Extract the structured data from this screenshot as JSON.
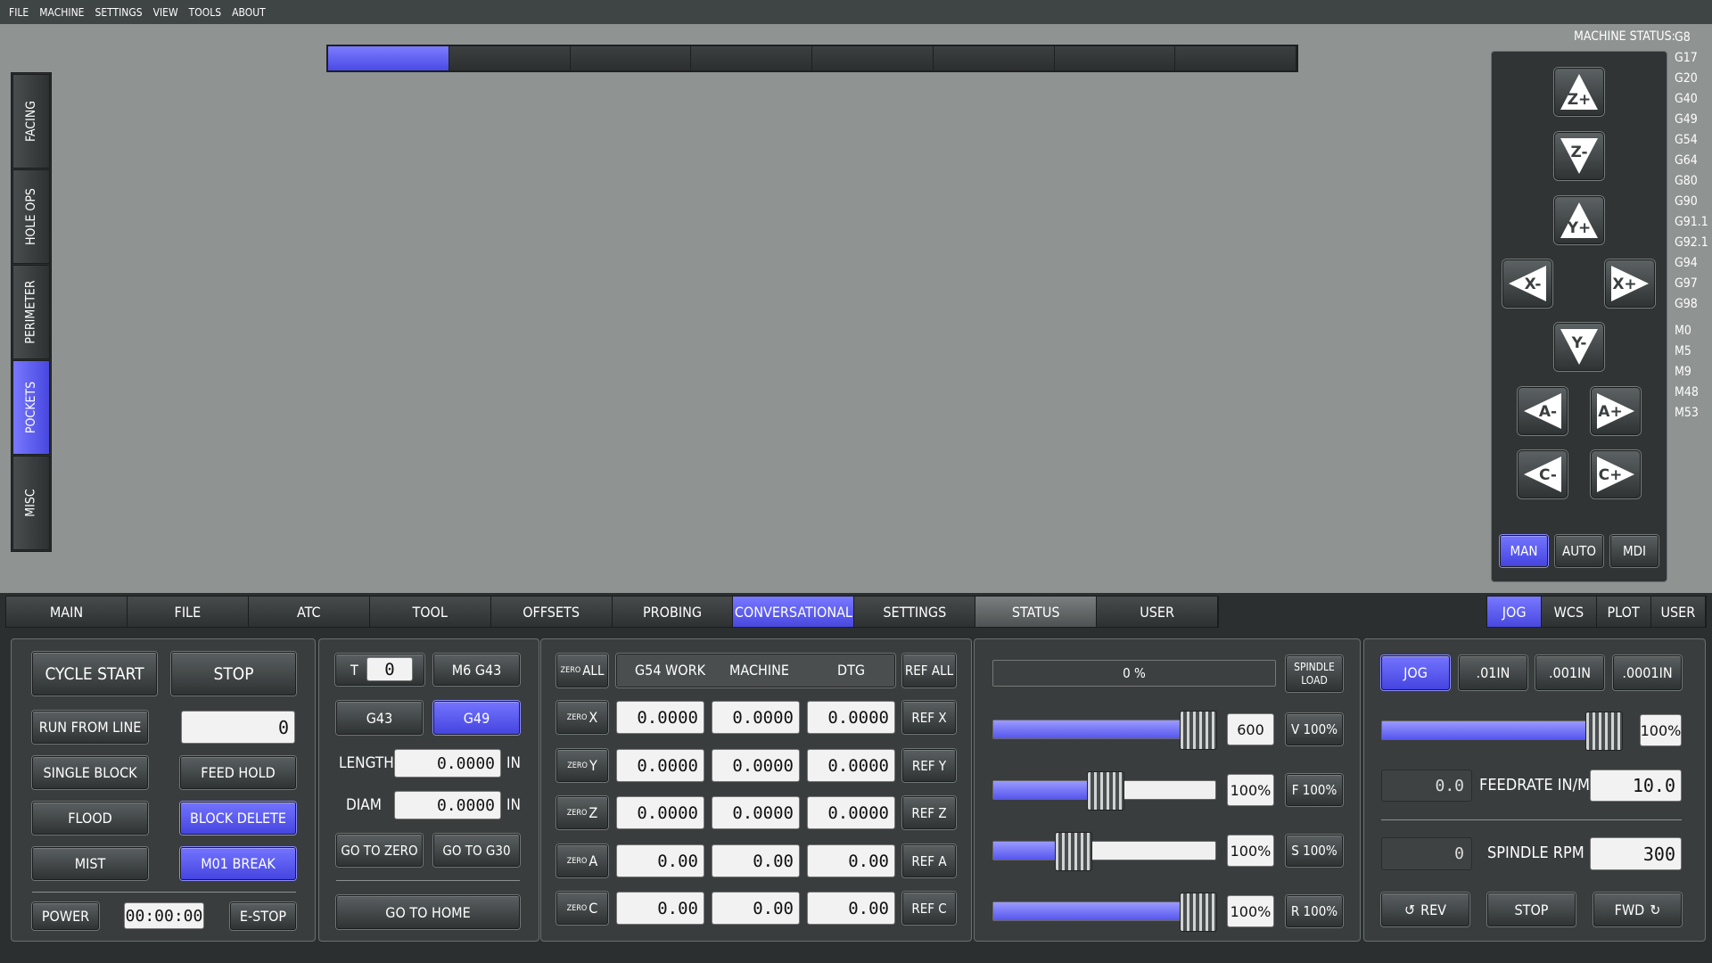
{
  "menu": [
    "FILE",
    "MACHINE",
    "SETTINGS",
    "VIEW",
    "TOOLS",
    "ABOUT"
  ],
  "machine_status_label": "MACHINE STATUS:",
  "gcodes": [
    "G8",
    "G17",
    "G20",
    "G40",
    "G49",
    "G54",
    "G64",
    "G80",
    "G90",
    "G91.1",
    "G92.1",
    "G94",
    "G97",
    "G98"
  ],
  "mcodes": [
    "M0",
    "M5",
    "M9",
    "M48",
    "M53"
  ],
  "side_tabs": [
    "FACING",
    "HOLE OPS",
    "PERIMETER",
    "POCKETS",
    "MISC"
  ],
  "side_tab_active": 3,
  "jog": {
    "z_plus": "Z+",
    "z_minus": "Z-",
    "y_plus": "Y+",
    "y_minus": "Y-",
    "x_minus": "X-",
    "x_plus": "X+",
    "a_minus": "A-",
    "a_plus": "A+",
    "c_minus": "C-",
    "c_plus": "C+"
  },
  "mode_buttons": [
    "MAN",
    "AUTO",
    "MDI"
  ],
  "main_tabs": [
    "MAIN",
    "FILE",
    "ATC",
    "TOOL",
    "OFFSETS",
    "PROBING",
    "CONVERSATIONAL",
    "SETTINGS",
    "STATUS",
    "USER"
  ],
  "right_tabs": [
    "JOG",
    "WCS",
    "PLOT",
    "USER"
  ],
  "controls": {
    "cycle_start": "CYCLE START",
    "stop": "STOP",
    "run_from_line": "RUN FROM LINE",
    "run_from_line_value": "0",
    "single_block": "SINGLE BLOCK",
    "feed_hold": "FEED HOLD",
    "flood": "FLOOD",
    "block_delete": "BLOCK DELETE",
    "mist": "MIST",
    "m01_break": "M01 BREAK",
    "power": "POWER",
    "timer": "00:00:00",
    "estop": "E-STOP"
  },
  "tool": {
    "t_label": "T",
    "t_value": "0",
    "m6g43": "M6 G43",
    "g43": "G43",
    "g49": "G49",
    "length_label": "LENGTH",
    "length_value": "0.0000",
    "length_unit": "IN",
    "diam_label": "DIAM",
    "diam_value": "0.0000",
    "diam_unit": "IN",
    "go_to_zero": "GO TO ZERO",
    "go_to_g30": "GO TO G30",
    "go_to_home": "GO TO HOME"
  },
  "dro": {
    "zero_all_small": "ZERO",
    "zero_all_big": "ALL",
    "headers": [
      "G54 WORK",
      "MACHINE",
      "DTG"
    ],
    "ref_all": "REF ALL",
    "rows": [
      {
        "axis": "X",
        "work": "0.0000",
        "machine": "0.0000",
        "dtg": "0.0000",
        "ref": "REF X"
      },
      {
        "axis": "Y",
        "work": "0.0000",
        "machine": "0.0000",
        "dtg": "0.0000",
        "ref": "REF Y"
      },
      {
        "axis": "Z",
        "work": "0.0000",
        "machine": "0.0000",
        "dtg": "0.0000",
        "ref": "REF Z"
      },
      {
        "axis": "A",
        "work": "0.00",
        "machine": "0.00",
        "dtg": "0.00",
        "ref": "REF A"
      },
      {
        "axis": "C",
        "work": "0.00",
        "machine": "0.00",
        "dtg": "0.00",
        "ref": "REF C"
      }
    ],
    "zero_small": "ZERO"
  },
  "overrides": {
    "load_text": "0 %",
    "load_fraction": 0.0,
    "spindle_load_1": "SPINDLE",
    "spindle_load_2": "LOAD",
    "rows": [
      {
        "value": "600",
        "button": "V 100%",
        "fraction": 1.0
      },
      {
        "value": "100%",
        "button": "F 100%",
        "fraction": 0.5
      },
      {
        "value": "100%",
        "button": "S 100%",
        "fraction": 0.33
      },
      {
        "value": "100%",
        "button": "R 100%",
        "fraction": 1.0
      }
    ]
  },
  "jog_panel": {
    "increments": [
      "JOG",
      ".01IN",
      ".001IN",
      ".0001IN"
    ],
    "jog_rate": "100%",
    "jog_fraction": 1.0,
    "feed_actual": "0.0",
    "feed_label": "FEEDRATE IN/M",
    "feed_set": "10.0",
    "spindle_actual": "0",
    "spindle_label": "SPINDLE RPM",
    "spindle_set": "300",
    "rev": "REV",
    "stop": "STOP",
    "fwd": "FWD"
  },
  "progress_segments": 8,
  "progress_active": 1
}
